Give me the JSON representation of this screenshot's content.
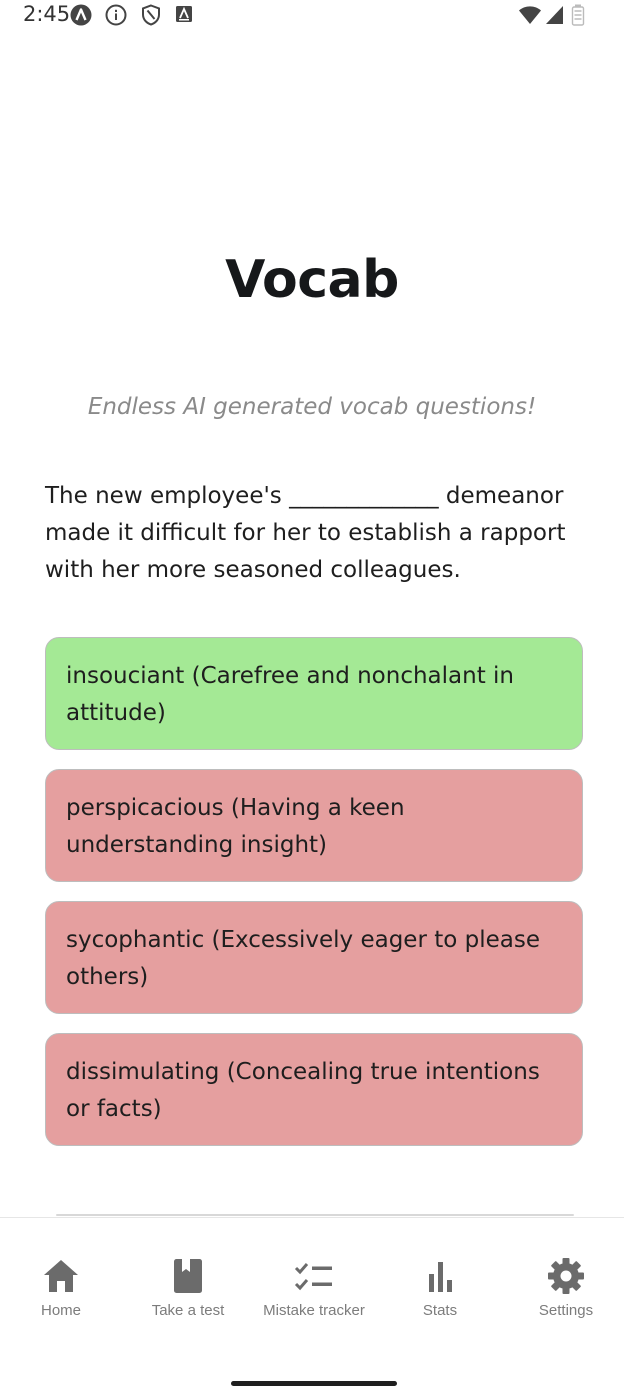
{
  "status_bar": {
    "time": "2:45",
    "icons": [
      "app-a-icon",
      "info-icon",
      "shield-icon",
      "keyboard-a-icon",
      "wifi-icon",
      "signal-icon",
      "battery-icon"
    ]
  },
  "header": {
    "title": "Vocab",
    "subtitle": "Endless AI generated vocab questions!"
  },
  "question": {
    "text": "The new employee's _____________ demeanor made it difficult for her to establish a rapport with her more seasoned colleagues."
  },
  "options": [
    {
      "label": "insouciant (Carefree and nonchalant in attitude)",
      "status": "correct",
      "color": "#a4e995"
    },
    {
      "label": "perspicacious (Having a keen understanding insight)",
      "status": "wrong",
      "color": "#e59f9f"
    },
    {
      "label": "sycophantic (Excessively eager to please others)",
      "status": "wrong",
      "color": "#e59f9f"
    },
    {
      "label": "dissimulating (Concealing true intentions or facts)",
      "status": "wrong",
      "color": "#e59f9f"
    }
  ],
  "bottom_nav": {
    "items": [
      {
        "label": "Home",
        "icon": "home-icon"
      },
      {
        "label": "Take a test",
        "icon": "book-icon"
      },
      {
        "label": "Mistake tracker",
        "icon": "checklist-icon"
      },
      {
        "label": "Stats",
        "icon": "bar-chart-icon"
      },
      {
        "label": "Settings",
        "icon": "gear-icon"
      }
    ]
  }
}
